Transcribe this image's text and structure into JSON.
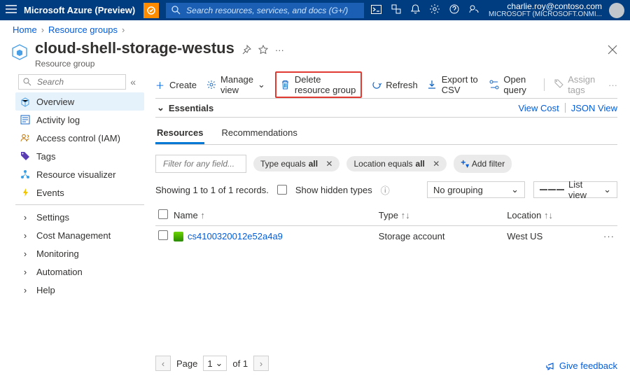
{
  "header": {
    "brand": "Microsoft Azure (Preview)",
    "search_placeholder": "Search resources, services, and docs (G+/)",
    "account_email": "charlie.roy@contoso.com",
    "account_tenant": "MICROSOFT (MICROSOFT.ONMI..."
  },
  "breadcrumbs": {
    "home": "Home",
    "rg": "Resource groups"
  },
  "page": {
    "title": "cloud-shell-storage-westus",
    "subtitle": "Resource group"
  },
  "sidebar": {
    "search_placeholder": "Search",
    "items": [
      "Overview",
      "Activity log",
      "Access control (IAM)",
      "Tags",
      "Resource visualizer",
      "Events"
    ],
    "footer": [
      "Settings",
      "Cost Management",
      "Monitoring",
      "Automation",
      "Help"
    ]
  },
  "toolbar": {
    "create": "Create",
    "manage": "Manage view",
    "delete": "Delete resource group",
    "refresh": "Refresh",
    "export": "Export to CSV",
    "open": "Open query",
    "assign": "Assign tags"
  },
  "essentials": {
    "label": "Essentials",
    "view_cost": "View Cost",
    "json": "JSON View"
  },
  "tabs": {
    "resources": "Resources",
    "recs": "Recommendations"
  },
  "filters": {
    "placeholder": "Filter for any field...",
    "type_pre": "Type equals ",
    "type_val": "all",
    "loc_pre": "Location equals ",
    "loc_val": "all",
    "add": "Add filter"
  },
  "listing": {
    "count_text": "Showing 1 to 1 of 1 records.",
    "hidden": "Show hidden types",
    "group": "No grouping",
    "view": "List view",
    "cols": {
      "name": "Name",
      "type": "Type",
      "loc": "Location"
    },
    "rows": [
      {
        "name": "cs4100320012e52a4a9",
        "type": "Storage account",
        "loc": "West US"
      }
    ]
  },
  "pager": {
    "page_label": "Page",
    "num": "1",
    "of": "of 1"
  },
  "feedback": "Give feedback"
}
